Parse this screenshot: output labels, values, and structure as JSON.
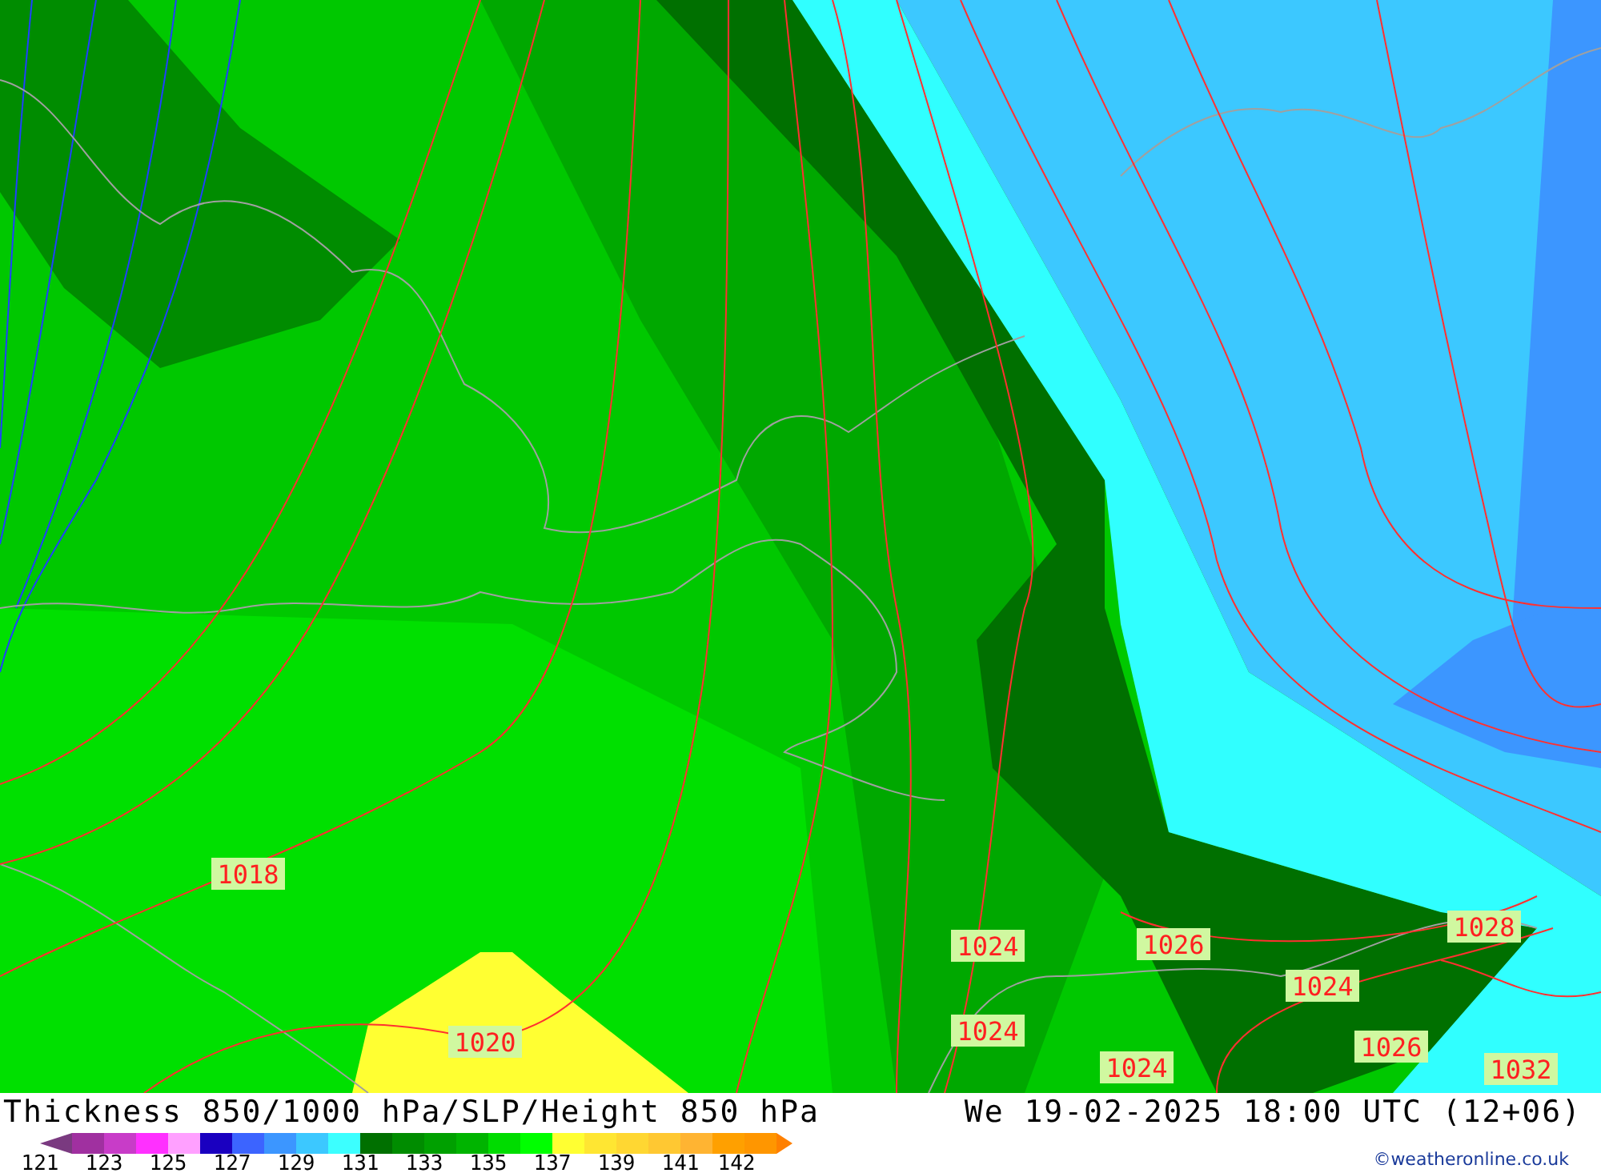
{
  "map": {
    "isobar_labels": [
      "1018",
      "1020",
      "1024",
      "1026",
      "1024",
      "1028",
      "1024",
      "1024",
      "1026",
      "1032"
    ]
  },
  "title": "Thickness 850/1000 hPa/SLP/Height 850 hPa",
  "valid_time": "We 19-02-2025 18:00 UTC (12+06)",
  "legend": {
    "swatches": [
      {
        "color": "#a030a0"
      },
      {
        "color": "#c83cc8"
      },
      {
        "color": "#ff30ff"
      },
      {
        "color": "#ffa0ff"
      },
      {
        "color": "#1a00c0"
      },
      {
        "color": "#3c64ff"
      },
      {
        "color": "#3c96ff"
      },
      {
        "color": "#3cc8ff"
      },
      {
        "color": "#3cffff"
      },
      {
        "color": "#007000"
      },
      {
        "color": "#008c00"
      },
      {
        "color": "#00a000"
      },
      {
        "color": "#00b400"
      },
      {
        "color": "#00dc00"
      },
      {
        "color": "#00ff00"
      },
      {
        "color": "#ffff32"
      },
      {
        "color": "#ffe632"
      },
      {
        "color": "#ffd732"
      },
      {
        "color": "#ffc832"
      },
      {
        "color": "#ffb432"
      },
      {
        "color": "#ffa000"
      },
      {
        "color": "#ff9600"
      }
    ],
    "ticks": [
      "121",
      "123",
      "125",
      "127",
      "129",
      "131",
      "133",
      "135",
      "137",
      "139",
      "141",
      "142"
    ]
  },
  "credit": "©weatheronline.co.uk"
}
